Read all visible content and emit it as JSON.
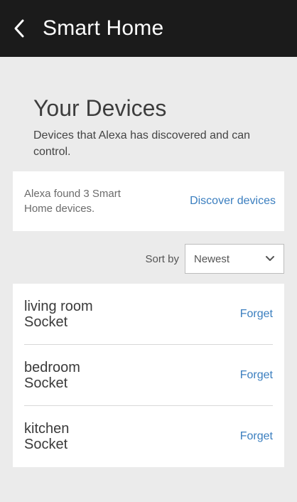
{
  "header": {
    "back_icon": "chevron-left-icon",
    "title": "Smart Home"
  },
  "devices_section": {
    "title": "Your Devices",
    "description": "Devices that Alexa has discovered and can control."
  },
  "discovery": {
    "found_text": "Alexa found 3 Smart Home devices.",
    "discover_label": "Discover devices"
  },
  "sort": {
    "label": "Sort by",
    "selected": "Newest",
    "dropdown_icon": "chevron-down-icon"
  },
  "devices": [
    {
      "name": "living room",
      "type": "Socket",
      "action": "Forget"
    },
    {
      "name": "bedroom",
      "type": "Socket",
      "action": "Forget"
    },
    {
      "name": "kitchen",
      "type": "Socket",
      "action": "Forget"
    }
  ],
  "colors": {
    "header_bg": "#1b1b1b",
    "page_bg": "#ebebeb",
    "link": "#3a7ebf"
  }
}
